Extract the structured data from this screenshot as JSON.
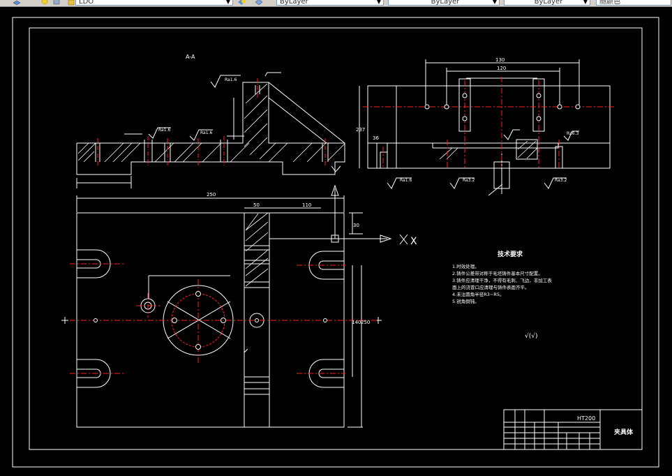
{
  "toolbar": {
    "layer_value": "LDO",
    "color_value": "ByLayer",
    "linetype_value": "ByLayer",
    "lineweight_value": "ByLayer",
    "plotstyle_value": "随颜色",
    "icons": [
      "layer-manager-icon",
      "sun-icon",
      "lock-icon",
      "layer-state-icon",
      "match-layer-icon",
      "layer-previous-icon"
    ]
  },
  "drawing": {
    "section_label": "A-A",
    "axis_x_label": "X",
    "tech_title": "技术要求",
    "tech_lines": [
      "1.时效处理。",
      "2.铸件公差带对称于毛坯铸件基本尺寸配置。",
      "3.铸件应清理干净，不得有毛刺、飞边，非加工表",
      "面上的浇冒口应清理与铸件表面齐平。",
      "4.未注圆角半径R3~R5。",
      "5.锐角倒钝。"
    ],
    "roughness_note": "√(√)",
    "material": "HT200",
    "part_name": "夹具体",
    "dims": {
      "overall_width": "250",
      "top_a": "50",
      "top_b": "110",
      "right_a": "30",
      "right_b": "140",
      "right_c": "250",
      "section_w1": "130",
      "section_w2": "120",
      "section_h": "237",
      "section_h2": "36"
    },
    "roughness_labels": [
      "Ra1.6",
      "Ra1.6",
      "Ra1.6",
      "Ra1.6",
      "Ra3.2",
      "Ra3.2",
      "Ra6.3"
    ]
  },
  "colors": {
    "line": "#ffffff",
    "center": "#ff2020",
    "background": "#000000",
    "toolbar": "#d4d0c8"
  }
}
